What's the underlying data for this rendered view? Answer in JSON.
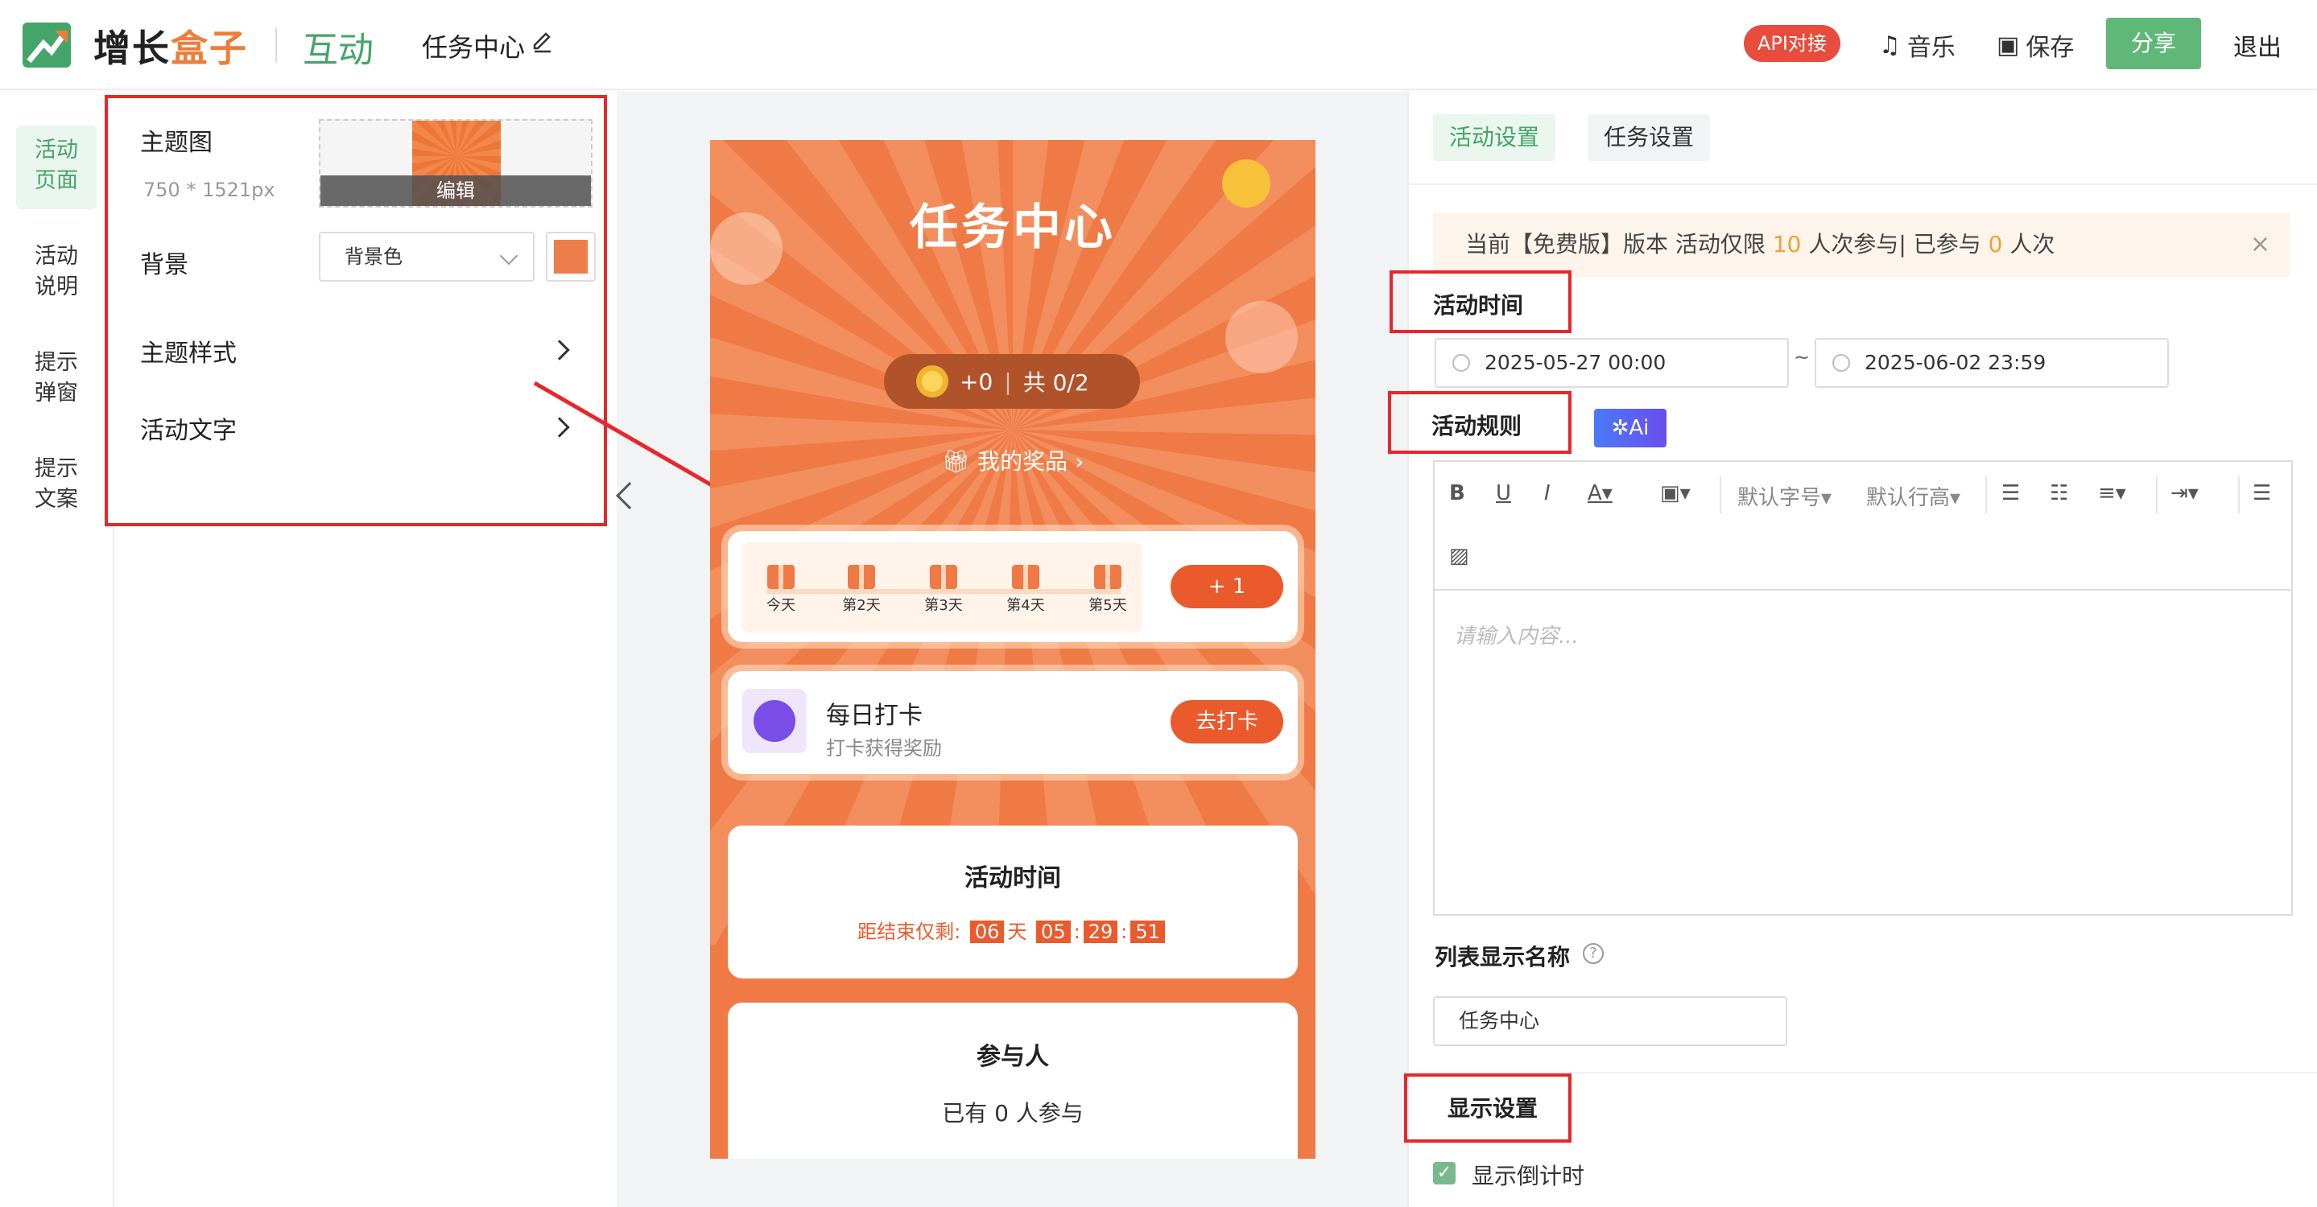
{
  "header": {
    "brand_part1": "增长",
    "brand_part2": "盒子",
    "module": "互动",
    "title": "任务中心",
    "api_label": "API对接",
    "music_label": "音乐",
    "save_label": "保存",
    "share_label": "分享",
    "logout_label": "退出"
  },
  "leftnav": {
    "items": [
      {
        "label": "活动\n页面",
        "l1": "活动",
        "l2": "页面"
      },
      {
        "l1": "活动",
        "l2": "说明"
      },
      {
        "l1": "提示",
        "l2": "弹窗"
      },
      {
        "l1": "提示",
        "l2": "文案"
      }
    ]
  },
  "config": {
    "theme_label": "主题图",
    "theme_size": "750 * 1521px",
    "edit_label": "编辑",
    "bg_label": "背景",
    "bg_select": "背景色",
    "bg_color": "#ee7d4c",
    "style_label": "主题样式",
    "text_label": "活动文字"
  },
  "phone": {
    "title": "任务中心",
    "coins": "+0",
    "total": "共 0/2",
    "prize_link": "我的奖品",
    "days": [
      "今天",
      "第2天",
      "第3天",
      "第4天",
      "第5天"
    ],
    "plus_btn": "+ 1",
    "checkin_title": "每日打卡",
    "checkin_sub": "打卡获得奖励",
    "checkin_btn": "去打卡",
    "time_title": "活动时间",
    "countdown_label": "距结束仅剩:",
    "cd_days": "06",
    "cd_day_unit": "天",
    "cd_h": "05",
    "cd_m": "29",
    "cd_s": "51",
    "participants_title": "参与人",
    "participants_text": "已有 0 人参与"
  },
  "right": {
    "tab_activity": "活动设置",
    "tab_task": "任务设置",
    "notice_a": "当前【免费版】版本 活动仅限 ",
    "notice_limit": "10",
    "notice_b": " 人次参与| 已参与 ",
    "notice_count": "0",
    "notice_c": " 人次",
    "time_label": "活动时间",
    "start": "2025-05-27 00:00",
    "tilde": "~",
    "end": "2025-06-02 23:59",
    "rules_label": "活动规则",
    "ai_label": "✲Ai",
    "font_size": "默认字号",
    "line_height": "默认行高",
    "editor_placeholder": "请输入内容...",
    "list_name_label": "列表显示名称",
    "list_name_value": "任务中心",
    "display_label": "显示设置",
    "show_countdown": "显示倒计时"
  }
}
